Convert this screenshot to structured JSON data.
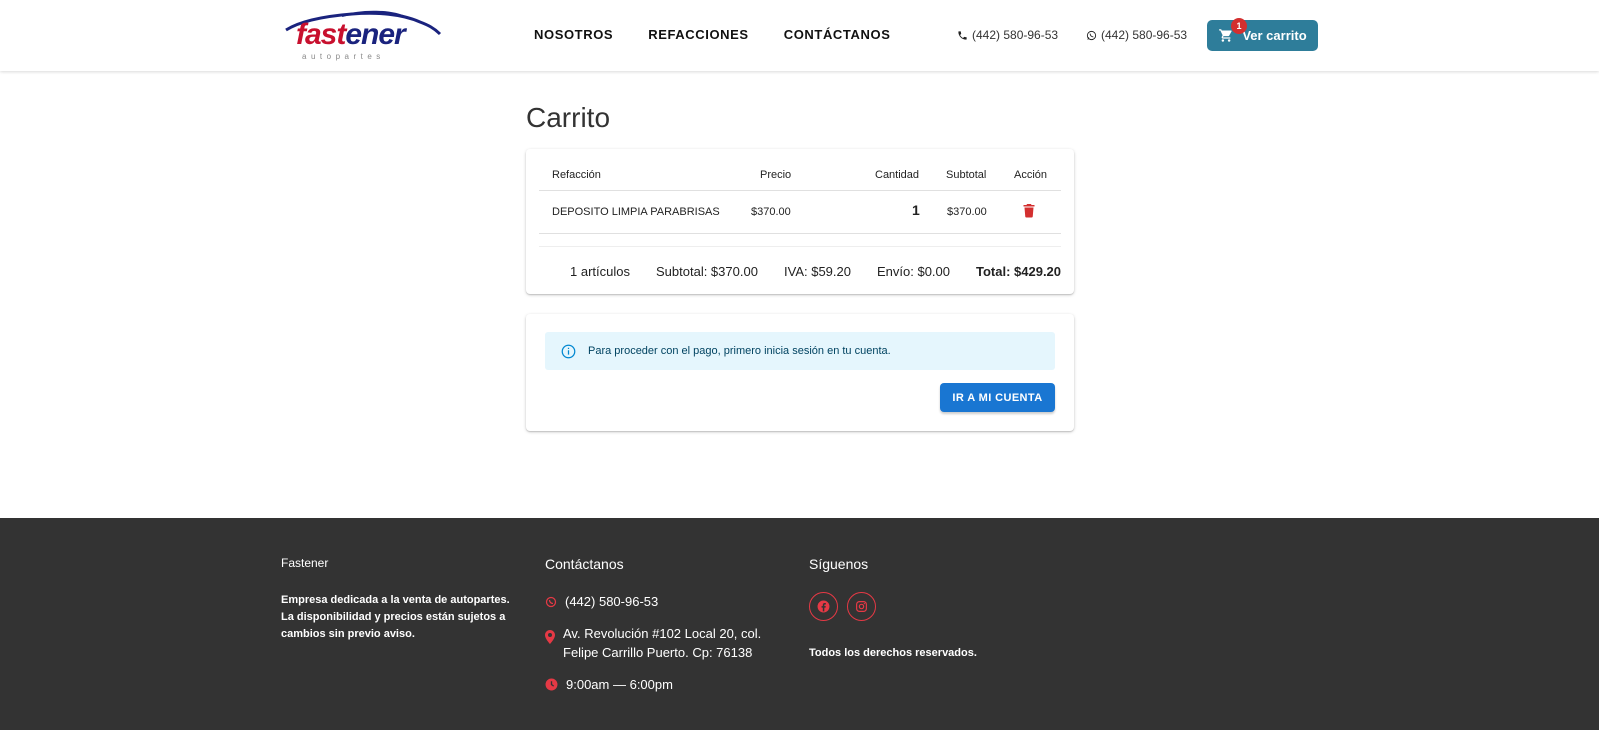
{
  "brand": {
    "logo_main_red": "fast",
    "logo_main_blue": "ener",
    "logo_sub": "autopartes",
    "colors": {
      "red": "#c8102e",
      "blue": "#1a237e"
    }
  },
  "nav": {
    "items": [
      {
        "label": "NOSOTROS"
      },
      {
        "label": "REFACCIONES"
      },
      {
        "label": "CONTÁCTANOS"
      }
    ]
  },
  "header": {
    "phone": "(442) 580-96-53",
    "whatsapp": "(442) 580-96-53",
    "cart_label": "Ver carrito",
    "cart_count": "1",
    "cart_color": "#2e7d9a"
  },
  "page": {
    "title": "Carrito"
  },
  "cart": {
    "columns": [
      "Refacción",
      "Precio",
      "Cantidad",
      "Subtotal",
      "Acción"
    ],
    "rows": [
      {
        "name": "DEPOSITO LIMPIA PARABRISAS",
        "price": "$370.00",
        "qty": "1",
        "subtotal": "$370.00",
        "action_icon": "trash-icon"
      }
    ],
    "summary": {
      "items": "1 artículos",
      "subtotal": "Subtotal: $370.00",
      "iva": "IVA: $59.20",
      "shipping": "Envío: $0.00",
      "total": "Total: $429.20"
    }
  },
  "login_notice": {
    "message": "Para proceder con el pago, primero inicia sesión en tu cuenta.",
    "button": "IR A MI CUENTA"
  },
  "footer": {
    "about_title": "Fastener",
    "about_text": "Empresa dedicada a la venta de autopartes. La disponibilidad y precios están sujetos a cambios sin previo aviso.",
    "contact_title": "Contáctanos",
    "contact_phone": "(442) 580-96-53",
    "contact_address": "Av. Revolución #102 Local 20, col. Felipe Carrillo Puerto. Cp: 76138",
    "contact_hours": "9:00am — 6:00pm",
    "social_title": "Síguenos",
    "rights": "Todos los derechos reservados."
  }
}
